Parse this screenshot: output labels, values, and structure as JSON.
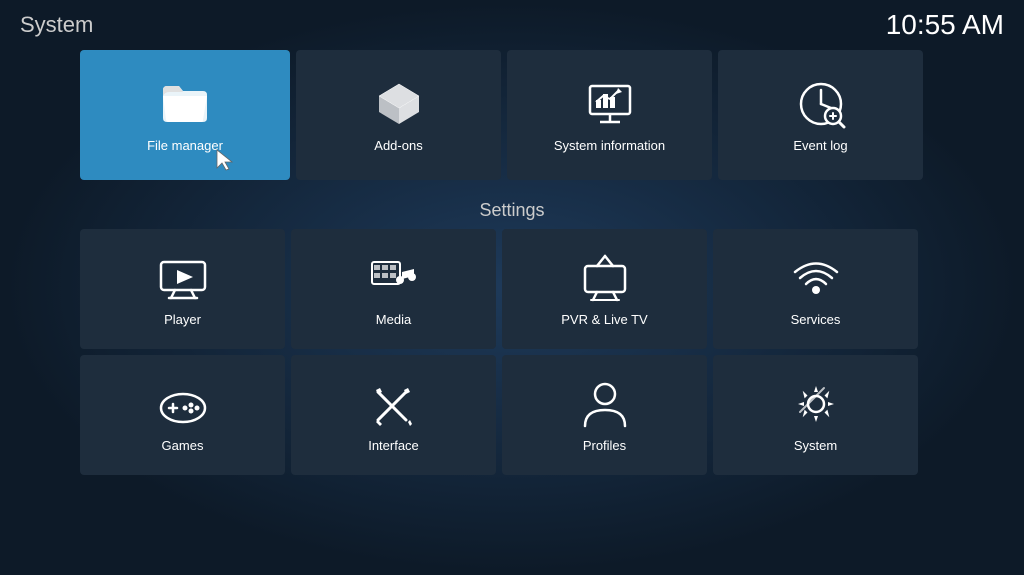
{
  "app": {
    "title": "System",
    "clock": "10:55 AM"
  },
  "top_tiles": [
    {
      "id": "file-manager",
      "label": "File manager",
      "highlighted": true
    },
    {
      "id": "add-ons",
      "label": "Add-ons"
    },
    {
      "id": "system-information",
      "label": "System information"
    },
    {
      "id": "event-log",
      "label": "Event log"
    }
  ],
  "settings_section": {
    "title": "Settings",
    "rows": [
      [
        {
          "id": "player",
          "label": "Player"
        },
        {
          "id": "media",
          "label": "Media"
        },
        {
          "id": "pvr-live-tv",
          "label": "PVR & Live TV"
        },
        {
          "id": "services",
          "label": "Services"
        }
      ],
      [
        {
          "id": "games",
          "label": "Games"
        },
        {
          "id": "interface",
          "label": "Interface"
        },
        {
          "id": "profiles",
          "label": "Profiles"
        },
        {
          "id": "system",
          "label": "System"
        }
      ]
    ]
  }
}
